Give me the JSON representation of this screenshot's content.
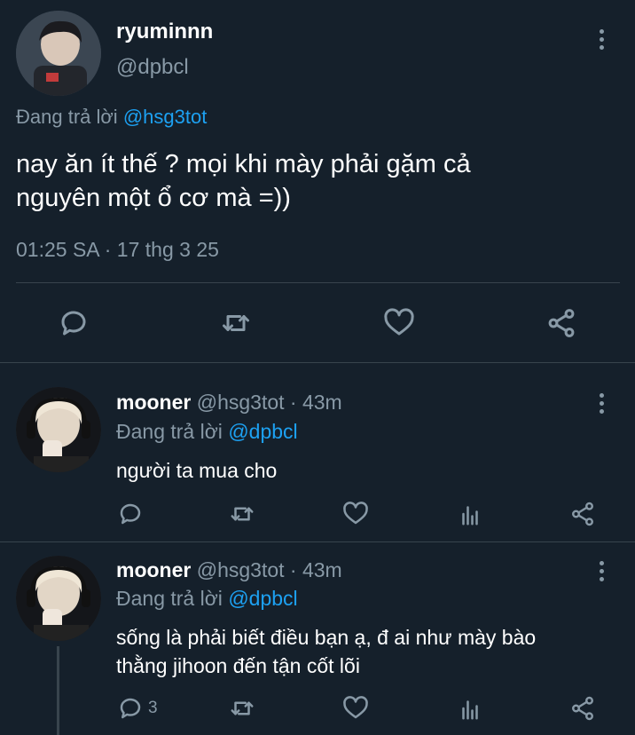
{
  "main_tweet": {
    "display_name": "ryuminnn",
    "handle": "@dpbcl",
    "replying_prefix": "Đang trả lời",
    "replying_to": "@hsg3tot",
    "text_line1": "nay ăn ít thế ? mọi khi mày phải gặm cả",
    "text_line2": "nguyên một ổ cơ mà =))",
    "timestamp": "01:25 SA · 17 thg 3 25"
  },
  "replies": [
    {
      "display_name": "mooner",
      "meta": "@hsg3tot · 43m",
      "replying_prefix": "Đang trả lời",
      "replying_to": "@dpbcl",
      "text_line1": "người ta mua cho",
      "text_line2": "",
      "reply_count": ""
    },
    {
      "display_name": "mooner",
      "meta": "@hsg3tot · 43m",
      "replying_prefix": "Đang trả lời",
      "replying_to": "@dpbcl",
      "text_line1": "sống là phải biết điều bạn ạ, đ ai như mày bào",
      "text_line2": "thằng jihoon đến tận cốt lõi",
      "reply_count": "3"
    }
  ],
  "icons": {
    "reply": "reply-icon",
    "retweet": "retweet-icon",
    "like": "heart-icon",
    "views": "analytics-icon",
    "share": "share-icon",
    "more": "more-options-icon"
  },
  "colors": {
    "background": "#15202b",
    "accent": "#1da1f2",
    "muted": "#8899a6",
    "divider": "#38444d"
  }
}
